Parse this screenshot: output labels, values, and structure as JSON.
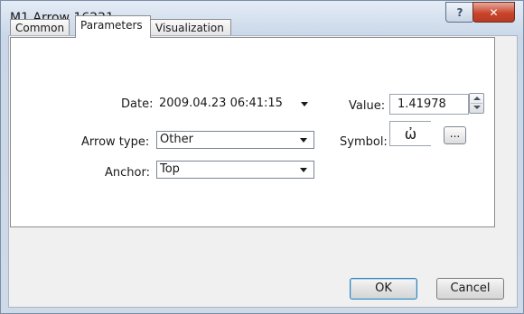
{
  "window": {
    "title": "M1 Arrow 16221",
    "help_label": "?",
    "close_label": "✕"
  },
  "tabs": [
    {
      "label": "Common"
    },
    {
      "label": "Parameters"
    },
    {
      "label": "Visualization"
    }
  ],
  "active_tab": "Parameters",
  "fields": {
    "date_label": "Date:",
    "date_value": "2009.04.23 06:41:15",
    "arrow_type_label": "Arrow type:",
    "arrow_type_value": "Other",
    "anchor_label": "Anchor:",
    "anchor_value": "Top",
    "value_label": "Value:",
    "value_value": "1.41978",
    "symbol_label": "Symbol:",
    "symbol_glyph": "ὠ",
    "browse_label": "..."
  },
  "buttons": {
    "ok_label": "OK",
    "cancel_label": "Cancel"
  },
  "colors": {
    "close_button": "#c9452c",
    "ok_focus": "#3c7fb1"
  }
}
